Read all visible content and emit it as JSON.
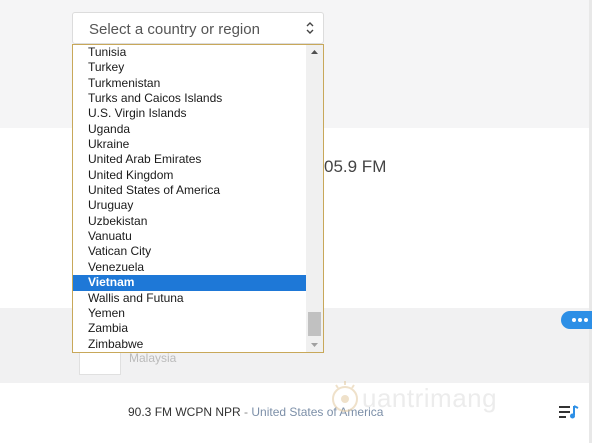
{
  "select": {
    "placeholder": "Select a country or region"
  },
  "listbox": {
    "options": [
      "Tunisia",
      "Turkey",
      "Turkmenistan",
      "Turks and Caicos Islands",
      "U.S. Virgin Islands",
      "Uganda",
      "Ukraine",
      "United Arab Emirates",
      "United Kingdom",
      "United States of America",
      "Uruguay",
      "Uzbekistan",
      "Vanuatu",
      "Vatican City",
      "Venezuela",
      "Vietnam",
      "Wallis and Futuna",
      "Yemen",
      "Zambia",
      "Zimbabwe"
    ],
    "selected": "Vietnam"
  },
  "station": {
    "frequency_partial": "05.9 FM",
    "country": "Malaysia"
  },
  "now_playing": {
    "station": "90.3 FM WCPN NPR",
    "separator": " - ",
    "country": "United States of America"
  },
  "watermark": {
    "text": "uantrimang"
  },
  "colors": {
    "accent_blue": "#2d8fe6",
    "selection_blue": "#1e78d7",
    "listbox_border": "#c8a85a"
  },
  "icons": {
    "select_arrows": "updown-chevron-icon",
    "more": "more-dots-icon",
    "playlist": "playlist-icon",
    "watermark_logo": "watermark-logo-icon"
  }
}
